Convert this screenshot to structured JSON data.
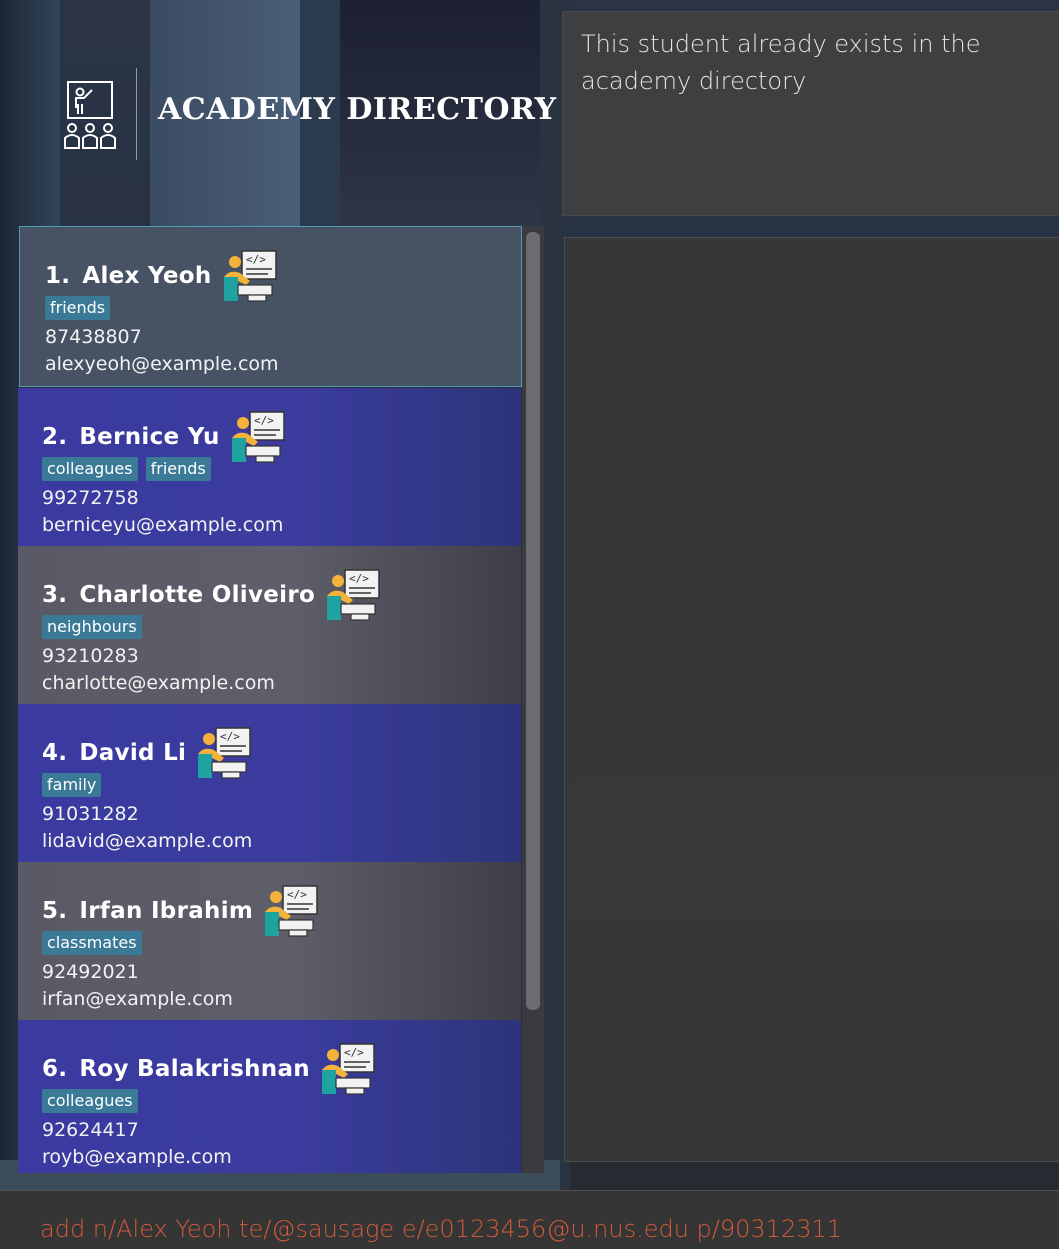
{
  "app": {
    "title": "ACADEMY DIRECTORY"
  },
  "result_display": {
    "message": "This student already exists in the academy directory"
  },
  "students": [
    {
      "index": "1.",
      "name": "Alex Yeoh",
      "tags": [
        "friends"
      ],
      "phone": "87438807",
      "email": "alexyeoh@example.com",
      "style": "sel"
    },
    {
      "index": "2.",
      "name": "Bernice Yu",
      "tags": [
        "colleagues",
        "friends"
      ],
      "phone": "99272758",
      "email": "berniceyu@example.com",
      "style": "blue"
    },
    {
      "index": "3.",
      "name": "Charlotte Oliveiro",
      "tags": [
        "neighbours"
      ],
      "phone": "93210283",
      "email": "charlotte@example.com",
      "style": "gray"
    },
    {
      "index": "4.",
      "name": "David Li",
      "tags": [
        "family"
      ],
      "phone": "91031282",
      "email": "lidavid@example.com",
      "style": "blue"
    },
    {
      "index": "5.",
      "name": "Irfan Ibrahim",
      "tags": [
        "classmates"
      ],
      "phone": "92492021",
      "email": "irfan@example.com",
      "style": "gray"
    },
    {
      "index": "6.",
      "name": "Roy Balakrishnan",
      "tags": [
        "colleagues"
      ],
      "phone": "92624417",
      "email": "royb@example.com",
      "style": "blue"
    }
  ],
  "command": {
    "value": "add n/Alex Yeoh te/@sausage e/e0123456@u.nus.edu p/90312311"
  },
  "icons": {
    "logo": "teacher-classroom-icon",
    "student_role": "programmer-icon"
  },
  "colors": {
    "tag": "#3b7a97",
    "selected_border": "#4f9bb3",
    "command_text": "#d15a3a"
  }
}
